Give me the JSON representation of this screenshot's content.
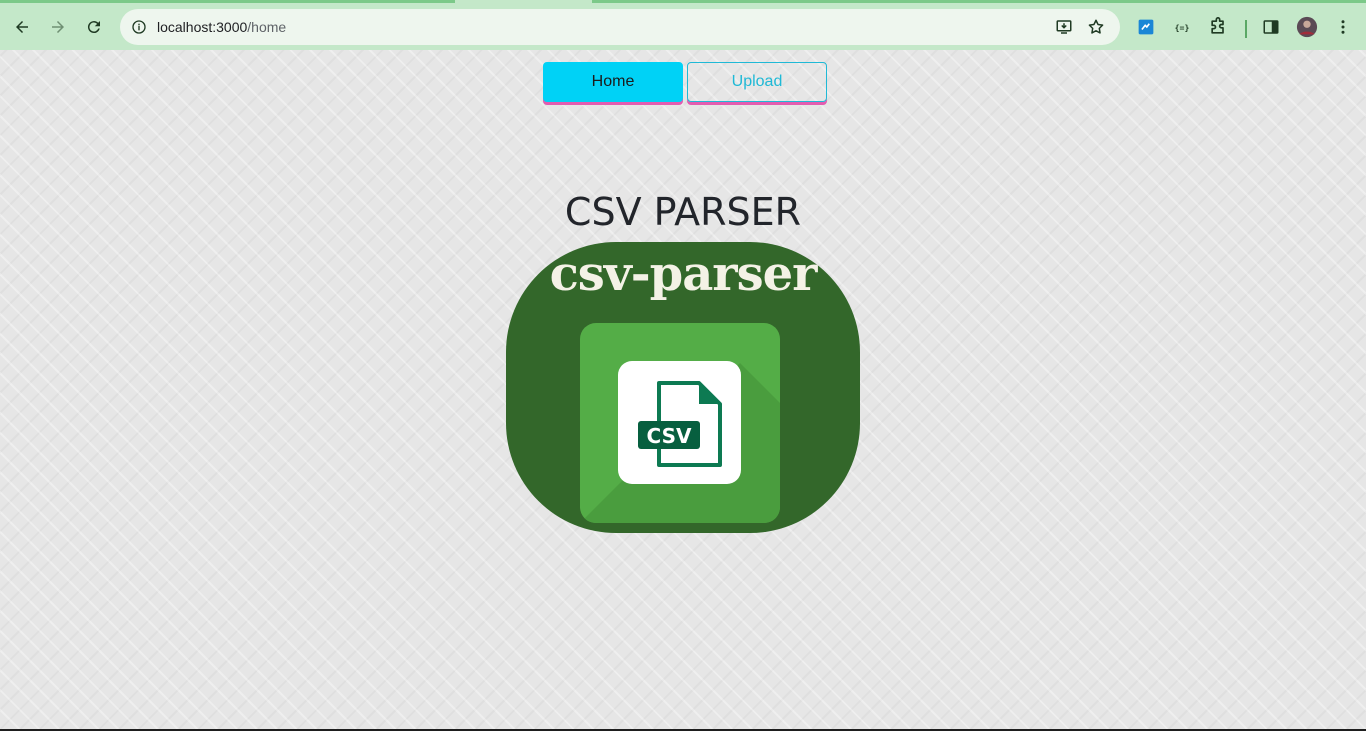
{
  "browser": {
    "url_host": "localhost:3000",
    "url_path": "/home"
  },
  "nav": {
    "home_label": "Home",
    "upload_label": "Upload"
  },
  "main": {
    "title": "CSV PARSER",
    "logo_text": "csv-parser",
    "logo_badge": "CSV"
  },
  "colors": {
    "accent_cyan": "#00d2f6",
    "accent_pink": "#e35cb0",
    "logo_dark_green": "#33672a",
    "logo_light_green": "#54ad47",
    "browser_frame": "#c4e8c9"
  }
}
